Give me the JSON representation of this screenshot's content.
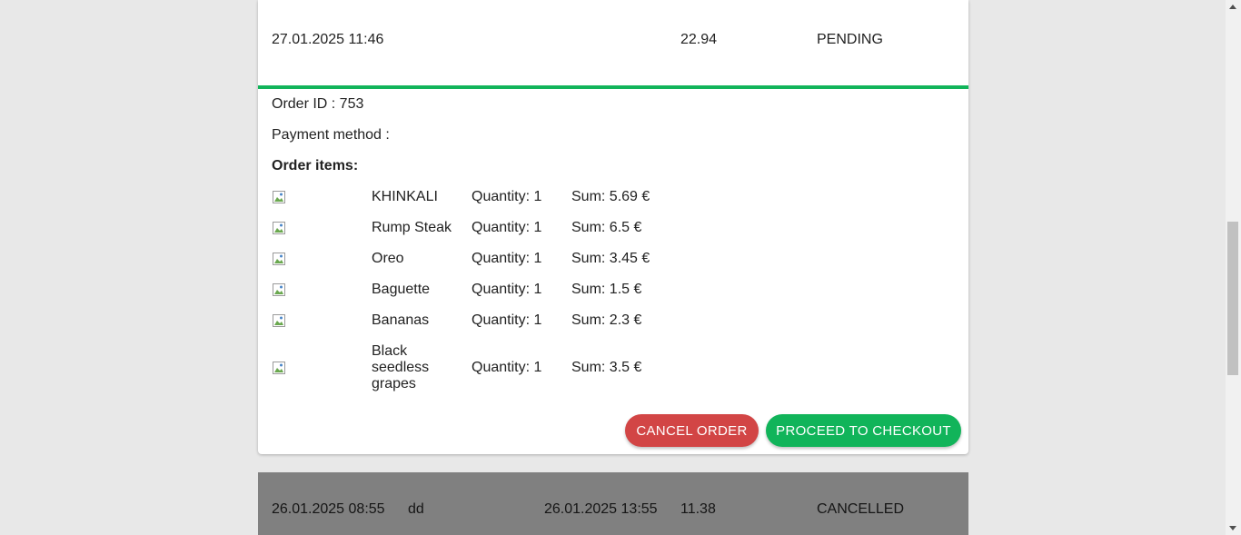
{
  "current_order": {
    "date": "27.01.2025 11:46",
    "total": "22.94",
    "status": "PENDING",
    "order_id_label": "Order ID : 753",
    "payment_method_label": "Payment method :",
    "items_heading": "Order items:",
    "items": [
      {
        "name": "KHINKALI",
        "quantity": "Quantity: 1",
        "sum": "Sum: 5.69 €"
      },
      {
        "name": "Rump Steak",
        "quantity": "Quantity: 1",
        "sum": "Sum: 6.5 €"
      },
      {
        "name": "Oreo",
        "quantity": "Quantity: 1",
        "sum": "Sum: 3.45 €"
      },
      {
        "name": "Baguette",
        "quantity": "Quantity: 1",
        "sum": "Sum: 1.5 €"
      },
      {
        "name": "Bananas",
        "quantity": "Quantity: 1",
        "sum": "Sum: 2.3 €"
      },
      {
        "name": "Black seedless grapes",
        "quantity": "Quantity: 1",
        "sum": "Sum: 3.5 €"
      }
    ],
    "cancel_label": "CANCEL ORDER",
    "proceed_label": "PROCEED TO CHECKOUT"
  },
  "next_order": {
    "date": "26.01.2025 08:55",
    "note": "dd",
    "date2": "26.01.2025 13:55",
    "total": "11.38",
    "status": "CANCELLED"
  },
  "colors": {
    "accent_green": "#11b45a",
    "cancel_red": "#d24545",
    "cancelled_row_bg": "#808080"
  }
}
